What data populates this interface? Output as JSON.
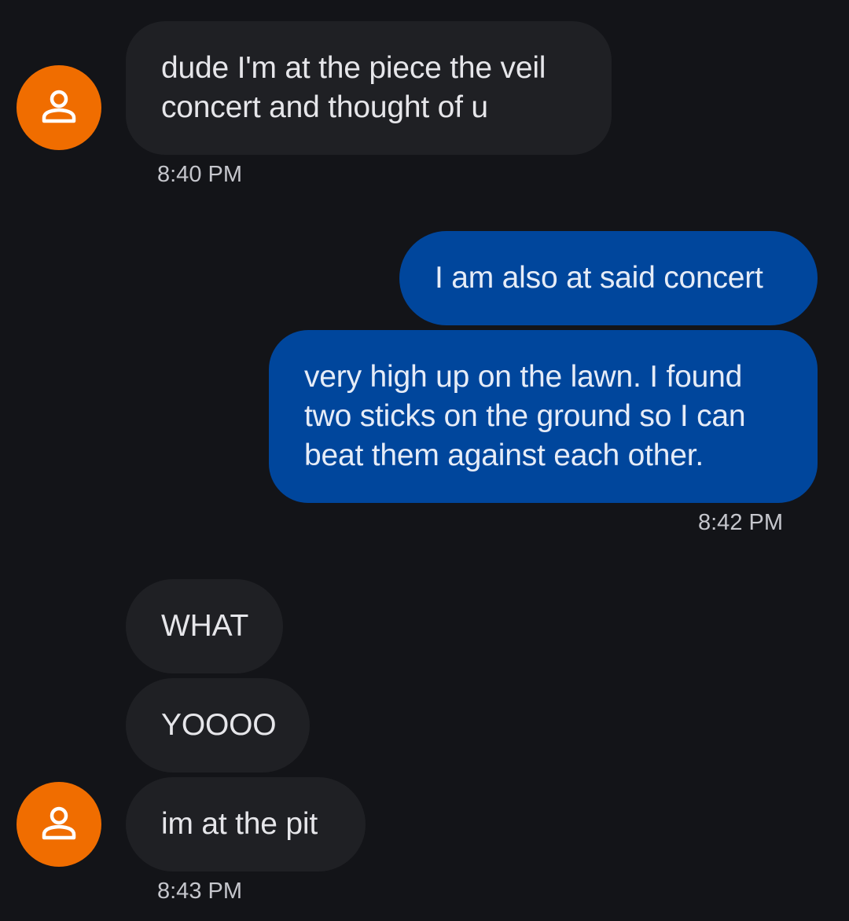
{
  "theme": {
    "background": "#131418",
    "incoming_bubble": "#1f2024",
    "outgoing_bubble": "#00469c",
    "avatar_color": "#f06d00"
  },
  "contact": {
    "avatar_icon": "person-outline-icon"
  },
  "messages": {
    "m1": {
      "text": "dude I'm at the piece the veil\nconcert and thought of u",
      "time": "8:40 PM"
    },
    "m2": {
      "text": "I am also at said concert"
    },
    "m3": {
      "text": "very high up on the lawn. I found\ntwo sticks on the ground so I can\nbeat them against each other.",
      "time": "8:42 PM"
    },
    "m4": {
      "text": "WHAT"
    },
    "m5": {
      "text": "YOOOO"
    },
    "m6": {
      "text": "im at the pit",
      "time": "8:43 PM"
    }
  }
}
